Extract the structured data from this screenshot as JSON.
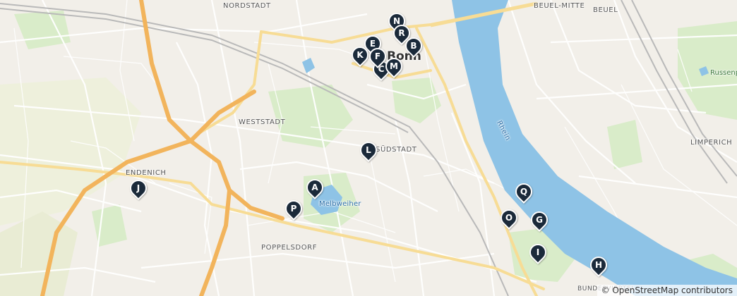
{
  "map": {
    "labels": {
      "nordstadt": "NORDSTADT",
      "beuel_mitte": "BEUEL-MITTE",
      "beuel": "BEUEL",
      "bonn": "Bonn",
      "weststadt": "WESTSTADT",
      "suedstadt": "SÜDSTADT",
      "endenich": "ENDENICH",
      "melbweiher": "Melbweiher",
      "poppelsdorf": "POPPELSDORF",
      "limperich": "LIMPERICH",
      "russenpark": "Russenp",
      "rhein": "Rhein",
      "bundesviertel": "BUNDESVIERTEL"
    },
    "markers": [
      {
        "letter": "N"
      },
      {
        "letter": "R"
      },
      {
        "letter": "E"
      },
      {
        "letter": "B"
      },
      {
        "letter": "K"
      },
      {
        "letter": "F"
      },
      {
        "letter": "C"
      },
      {
        "letter": "M"
      },
      {
        "letter": "L"
      },
      {
        "letter": "J"
      },
      {
        "letter": "A"
      },
      {
        "letter": "P"
      },
      {
        "letter": "Q"
      },
      {
        "letter": "O"
      },
      {
        "letter": "G"
      },
      {
        "letter": "I"
      },
      {
        "letter": "H"
      }
    ],
    "attribution": "© OpenStreetMap contributors",
    "colors": {
      "land": "#f2efe9",
      "water": "#8ec3e6",
      "motorway": "#f2b45c",
      "green": "#d9ecc9",
      "marker": "#1b2a3a"
    }
  }
}
